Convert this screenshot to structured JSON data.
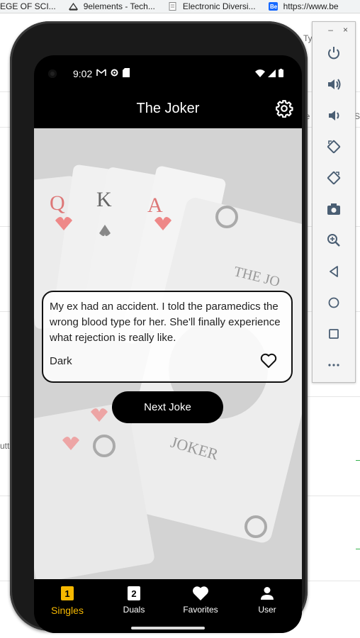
{
  "browser": {
    "tabs": [
      {
        "label": "EGE OF SCI..."
      },
      {
        "label": "9elements - Tech..."
      },
      {
        "label": "Electronic Diversi..."
      },
      {
        "label": "https://www.be"
      }
    ]
  },
  "background": {
    "fragments": [
      "Ty",
      "je",
      "utt",
      "S"
    ]
  },
  "emulator": {
    "minimize": "–",
    "close": "×"
  },
  "status_bar": {
    "time": "9:02"
  },
  "app": {
    "title": "The Joker"
  },
  "joke": {
    "text": "My ex had an accident. I told the paramedics the wrong blood type for her. She'll finally experience what rejection is really like.",
    "category": "Dark"
  },
  "next_button": {
    "label": "Next Joke"
  },
  "bottom_nav": {
    "items": [
      {
        "label": "Singles",
        "badge": "1",
        "active": true
      },
      {
        "label": "Duals",
        "badge": "2",
        "active": false
      },
      {
        "label": "Favorites",
        "active": false
      },
      {
        "label": "User",
        "active": false
      }
    ]
  },
  "colors": {
    "accent": "#f6b800",
    "app_bg": "#000000"
  }
}
